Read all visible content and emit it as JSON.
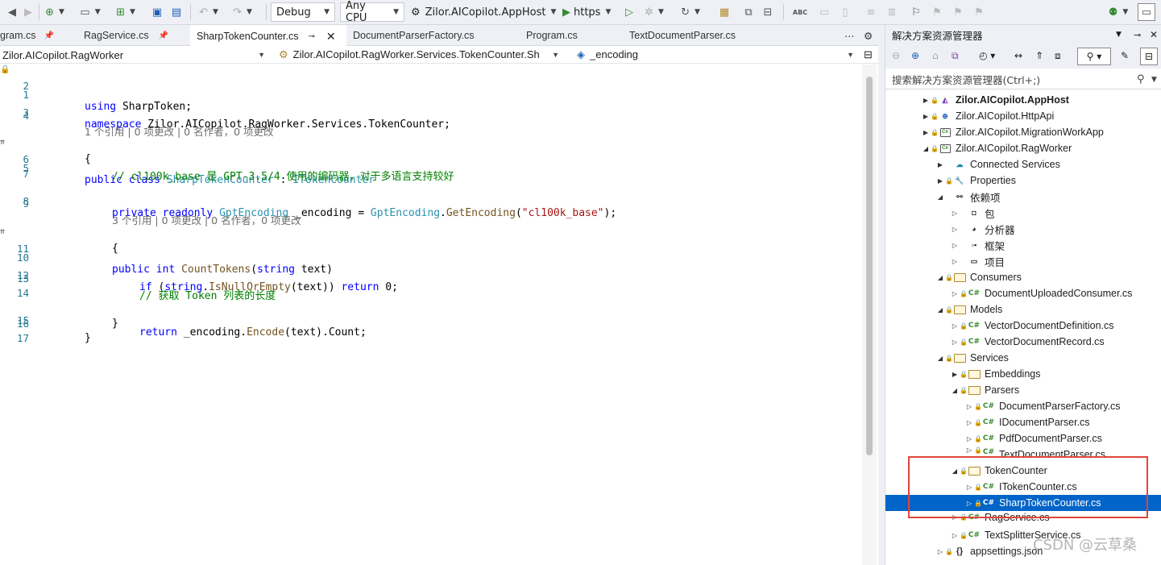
{
  "toolbar": {
    "config": "Debug",
    "platform": "Any CPU",
    "startup": "Zilor.AICopilot.AppHost",
    "run_profile": "https"
  },
  "tabs": [
    {
      "label": "gram.cs"
    },
    {
      "label": "RagService.cs"
    },
    {
      "label": "SharpTokenCounter.cs"
    },
    {
      "label": "DocumentParserFactory.cs"
    },
    {
      "label": "Program.cs"
    },
    {
      "label": "TextDocumentParser.cs"
    }
  ],
  "navbar": {
    "project": "Zilor.AICopilot.RagWorker",
    "type": "Zilor.AICopilot.RagWorker.Services.TokenCounter.Sh",
    "member": "_encoding"
  },
  "code": {
    "l1_kw": "using",
    "l1_rest": " SharpToken;",
    "l3_kw": "namespace",
    "l3_rest": " Zilor.AICopilot.RagWorker.Services.TokenCounter;",
    "lens1": "1 个引用 | 0 项更改 | 0 名作者，0 项更改",
    "l5_kw1": "public",
    "l5_kw2": "class",
    "l5_type": "SharpTokenCounter",
    "l5_colon": " : ",
    "l5_iface": "ITokenCounter",
    "l6": "{",
    "l7_comment": "// cl100k_base 是 GPT-3.5/4 使用的编码器，对于多语言支持较好",
    "l8_kw1": "private",
    "l8_kw2": "readonly",
    "l8_type": "GptEncoding",
    "l8_field": " _encoding = ",
    "l8_type2": "GptEncoding",
    "l8_method": "GetEncoding",
    "l8_str": "\"cl100k_base\"",
    "l8_end": ");",
    "lens2": "3 个引用 | 0 项更改 | 0 名作者，0 项更改",
    "l10_kw1": "public",
    "l10_kw2": "int",
    "l10_method": "CountTokens",
    "l10_kw3": "string",
    "l10_rest": " text)",
    "l11": "{",
    "l12_kw1": "if",
    "l12_kw2": "string",
    "l12_method": "IsNullOrEmpty",
    "l12_mid": "(text)) ",
    "l12_kw3": "return",
    "l12_end": " 0;",
    "l14_comment": "// 获取 Token 列表的长度",
    "l15_kw": "return",
    "l15_a": " _encoding.",
    "l15_method": "Encode",
    "l15_end": "(text).Count;",
    "l16": "}",
    "l17": "}"
  },
  "line_numbers": [
    "1",
    "2",
    "3",
    "4",
    "5",
    "6",
    "7",
    "8",
    "9",
    "10",
    "11",
    "12",
    "13",
    "14",
    "15",
    "16",
    "17"
  ],
  "solution_explorer": {
    "title": "解决方案资源管理器",
    "search_placeholder": "搜索解决方案资源管理器(Ctrl+;)",
    "items": [
      {
        "label": "Zilor.AICopilot.AppHost"
      },
      {
        "label": "Zilor.AICopilot.HttpApi"
      },
      {
        "label": "Zilor.AICopilot.MigrationWorkApp"
      },
      {
        "label": "Zilor.AICopilot.RagWorker"
      },
      {
        "label": "Connected Services"
      },
      {
        "label": "Properties"
      },
      {
        "label": "依赖项"
      },
      {
        "label": "包"
      },
      {
        "label": "分析器"
      },
      {
        "label": "框架"
      },
      {
        "label": "项目"
      },
      {
        "label": "Consumers"
      },
      {
        "label": "DocumentUploadedConsumer.cs"
      },
      {
        "label": "Models"
      },
      {
        "label": "VectorDocumentDefinition.cs"
      },
      {
        "label": "VectorDocumentRecord.cs"
      },
      {
        "label": "Services"
      },
      {
        "label": "Embeddings"
      },
      {
        "label": "Parsers"
      },
      {
        "label": "DocumentParserFactory.cs"
      },
      {
        "label": "IDocumentParser.cs"
      },
      {
        "label": "PdfDocumentParser.cs"
      },
      {
        "label": "TextDocumentParser.cs"
      },
      {
        "label": "TokenCounter"
      },
      {
        "label": "ITokenCounter.cs"
      },
      {
        "label": "SharpTokenCounter.cs"
      },
      {
        "label": "RagService.cs"
      },
      {
        "label": "TextSplitterService.cs"
      },
      {
        "label": "appsettings.json"
      }
    ]
  },
  "watermark": "CSDN @云草桑",
  "colors": {
    "selection": "#0064c8",
    "highlight_box": "#e0453c"
  }
}
